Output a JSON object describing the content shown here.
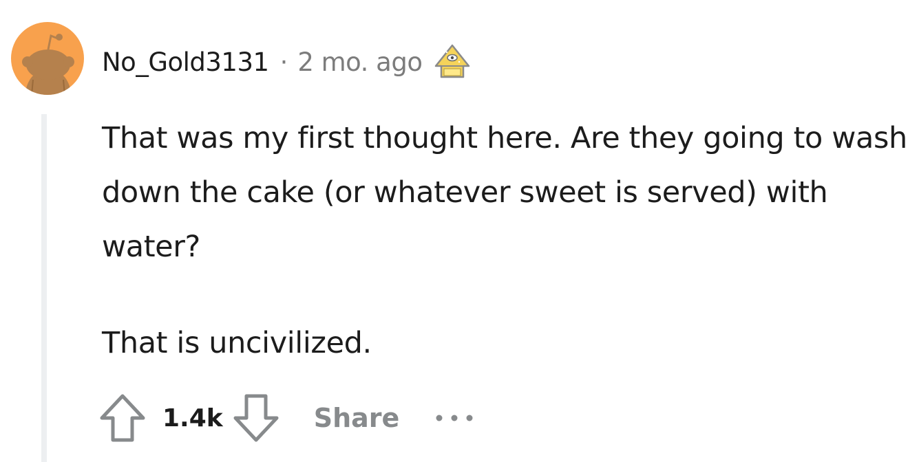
{
  "comment": {
    "author": "No_Gold3131",
    "separator": "·",
    "timestamp": "2 mo. ago",
    "award_icon": "pyramid-award-icon",
    "body": [
      "That was my first thought here. Are they going to wash down the cake (or whatever sweet is served) with water?",
      "That is uncivilized."
    ],
    "score": "1.4k",
    "share_label": "Share",
    "colors": {
      "avatar_bg": "#f8a14d",
      "avatar_figure": "#b5814d",
      "thread_line": "#edeff1",
      "text": "#1c1c1c",
      "muted": "#878a8c"
    }
  }
}
